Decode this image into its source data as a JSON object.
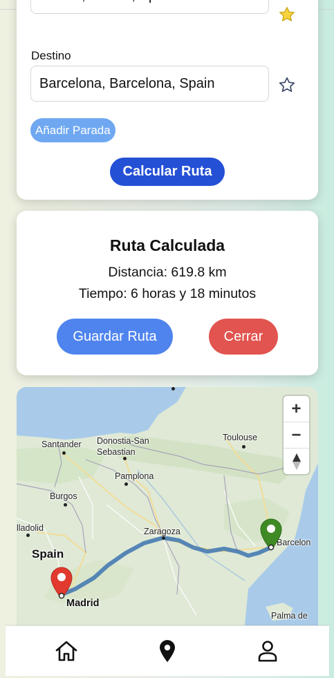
{
  "form": {
    "origin_value": "Madrid, Madrid, Spain",
    "destination_label": "Destino",
    "destination_value": "Barcelona, Barcelona, Spain",
    "add_stop_label": "Añadir Parada",
    "calculate_label": "Calcular Ruta",
    "origin_favorite": true,
    "destination_favorite": false
  },
  "result": {
    "title": "Ruta Calculada",
    "distance": "Distancia: 619.8 km",
    "time": "Tiempo: 6 horas y 18 minutos",
    "save_label": "Guardar Ruta",
    "close_label": "Cerrar"
  },
  "map": {
    "cities": {
      "santander": "Santander",
      "donostia": "Donostia-San Sebastian",
      "toulouse": "Toulouse",
      "pamplona": "Pamplona",
      "burgos": "Burgos",
      "valladolid": "lladolid",
      "zaragoza": "Zaragoza",
      "spain": "Spain",
      "madrid": "Madrid",
      "barcelona": "Barcelon",
      "palma": "Palma de"
    },
    "zoom_in": "+",
    "zoom_out": "−",
    "route_color": "#3d74b0",
    "origin_marker_color": "#e23a2e",
    "destination_marker_color": "#3f8a24"
  },
  "colors": {
    "primary": "#2450d6",
    "add_stop": "#6fa8f1",
    "save": "#4f84ee",
    "close": "#e2544f"
  },
  "nav": {
    "icons": [
      "home-icon",
      "map-pin-icon",
      "user-icon"
    ]
  }
}
